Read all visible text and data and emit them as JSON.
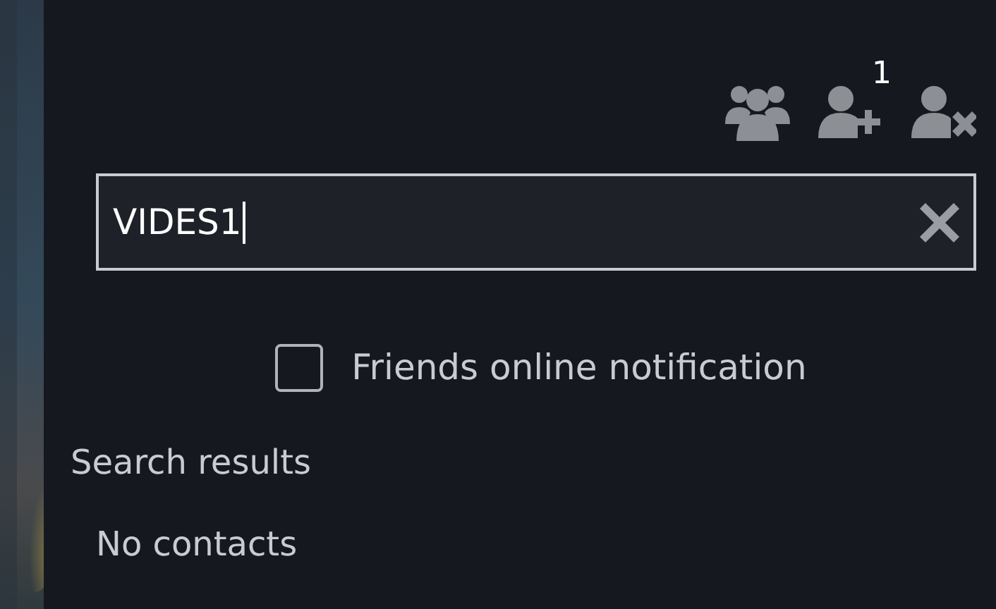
{
  "toolbar": {
    "add_friend_badge": "1"
  },
  "search": {
    "value": "VIDES1"
  },
  "notification_option": {
    "label": "Friends online notification",
    "checked": false
  },
  "results": {
    "title": "Search results",
    "empty_text": "No contacts"
  }
}
